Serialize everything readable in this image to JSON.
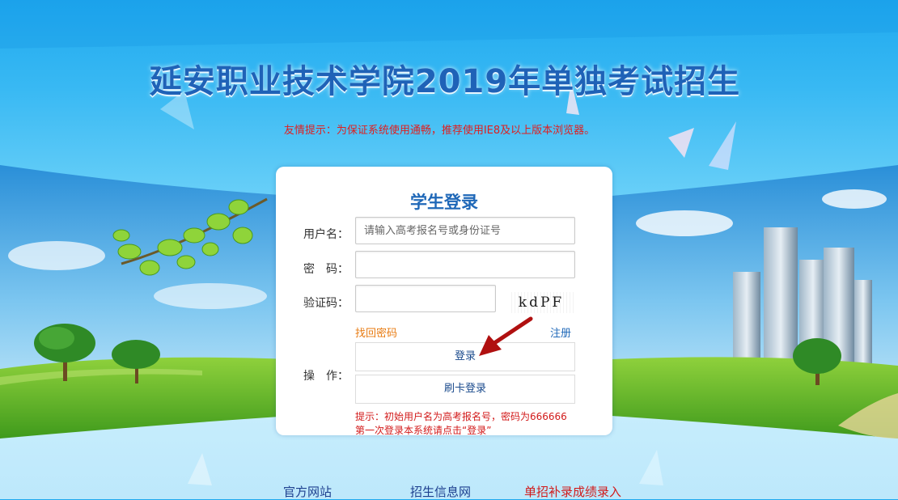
{
  "header": {
    "title": "延安职业技术学院2019年单独考试招生",
    "notice": "友情提示：为保证系统使用通畅，推荐使用IE8及以上版本浏览器。"
  },
  "login": {
    "title": "学生登录",
    "username_label": "用户名：",
    "username_placeholder": "请输入高考报名号或身份证号",
    "username_value": "",
    "password_label": "密　码：",
    "password_value": "",
    "captcha_label": "验证码：",
    "captcha_value": "",
    "captcha_image_text": "kdPF",
    "forgot_password": "找回密码",
    "register": "注册",
    "actions_label": "操　作：",
    "login_button": "登录",
    "card_login_button": "刷卡登录",
    "hint_line1": "提示：初始用户名为高考报名号，密码为666666",
    "hint_line2": "第一次登录本系统请点击“登录”"
  },
  "footer_links": [
    {
      "label": "官方网站",
      "color": "#1d3f8f"
    },
    {
      "label": "招生信息网",
      "color": "#1d3f8f"
    },
    {
      "label": "单招补录成绩录入",
      "color": "#d11b1b"
    }
  ],
  "colors": {
    "title": "#1f62b7",
    "notice": "#e01e1e",
    "forgot_link": "#e87b12",
    "register_link": "#1f68b8",
    "hint": "#d21a1a",
    "arrow": "#b01010"
  },
  "icons": {
    "arrow": "red-arrow-pointing-to-login"
  }
}
